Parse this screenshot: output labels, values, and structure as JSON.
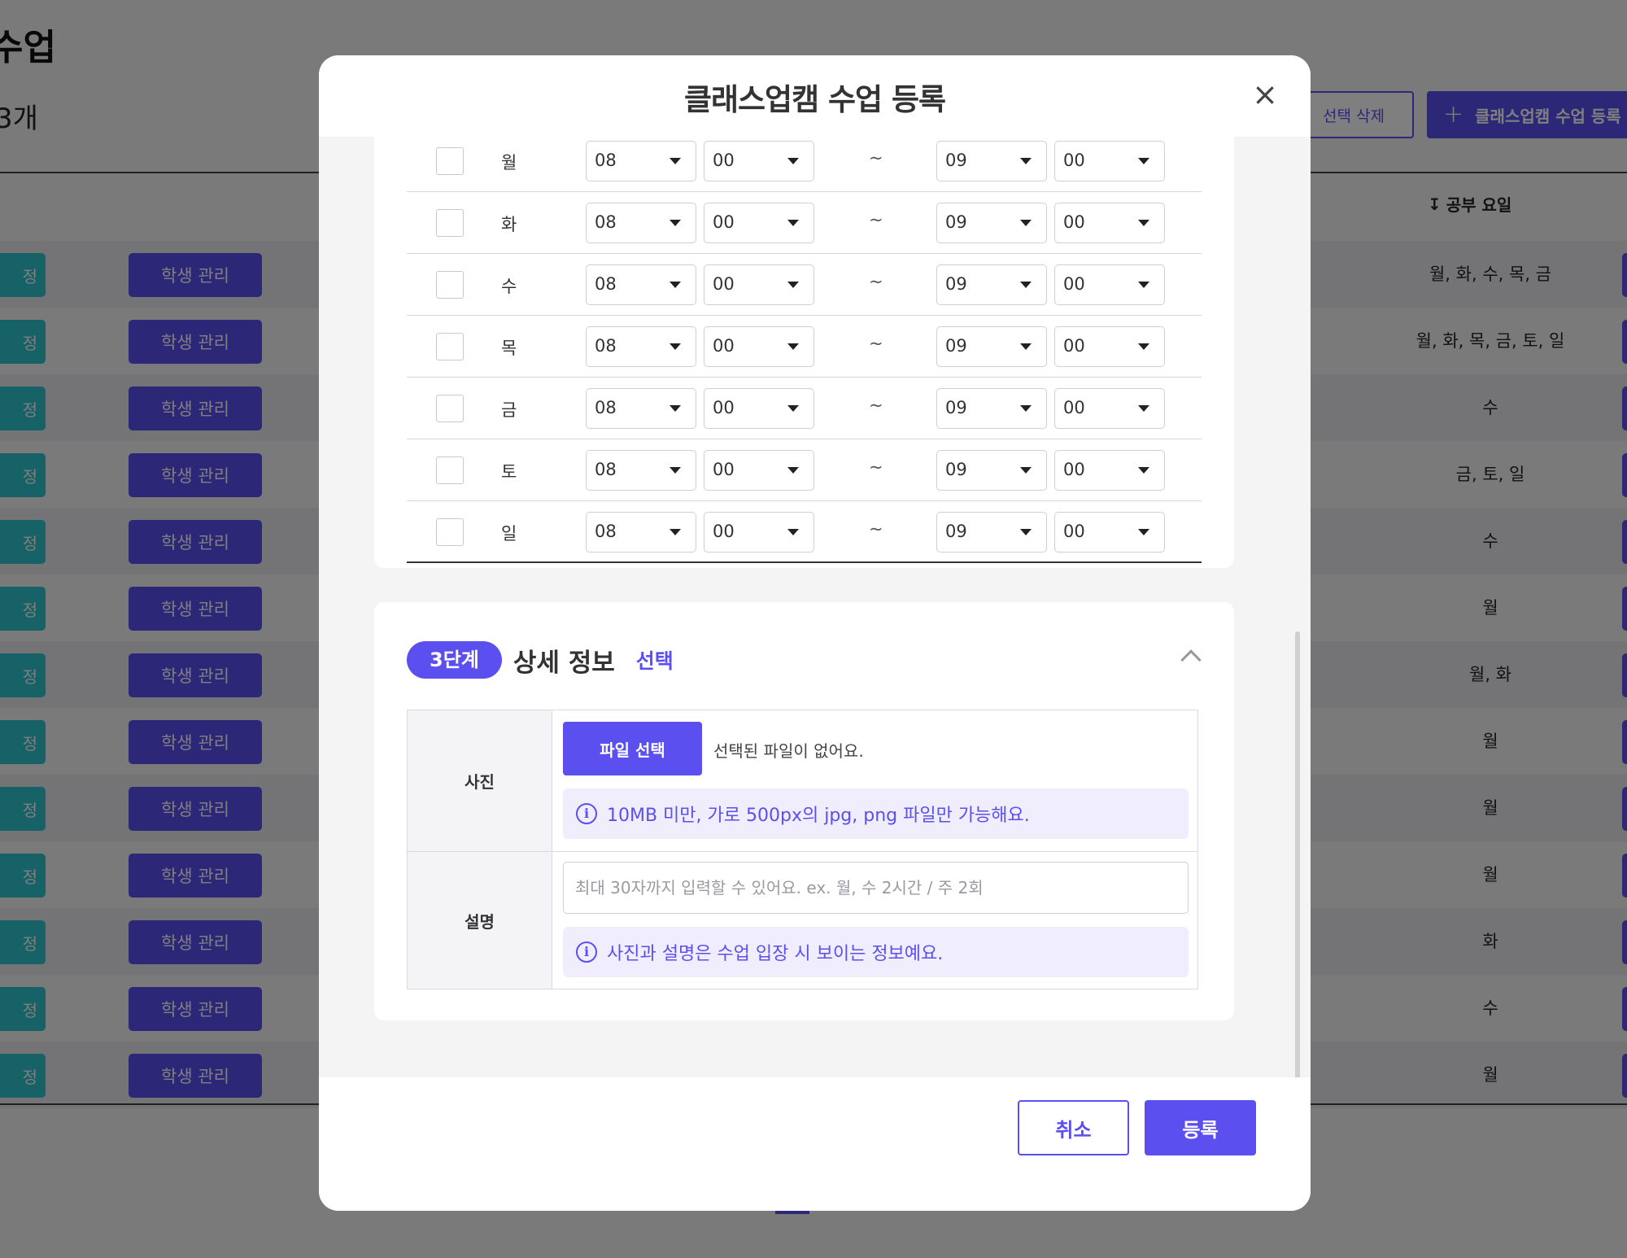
{
  "background": {
    "page_title": "수업",
    "count_text": "3개",
    "delete_button": "선택 삭제",
    "register_button": "클래스업캠 수업 등록",
    "day_column_header": "공부 요일",
    "row_teal_label": "정",
    "row_manage_label": "학생 관리",
    "rows": [
      {
        "days": "월, 화, 수, 목, 금"
      },
      {
        "days": "월, 화, 목, 금, 토, 일"
      },
      {
        "days": "수"
      },
      {
        "days": "금, 토, 일"
      },
      {
        "days": "수"
      },
      {
        "days": "월"
      },
      {
        "days": "월, 화"
      },
      {
        "days": "월"
      },
      {
        "days": "월"
      },
      {
        "days": "월"
      },
      {
        "days": "화"
      },
      {
        "days": "수"
      },
      {
        "days": "월"
      }
    ]
  },
  "modal": {
    "title": "클래스업캠 수업 등록",
    "close_label": "×",
    "schedule": {
      "rows": [
        {
          "day": "월",
          "start_hour": "08",
          "start_min": "00",
          "end_hour": "09",
          "end_min": "00"
        },
        {
          "day": "화",
          "start_hour": "08",
          "start_min": "00",
          "end_hour": "09",
          "end_min": "00"
        },
        {
          "day": "수",
          "start_hour": "08",
          "start_min": "00",
          "end_hour": "09",
          "end_min": "00"
        },
        {
          "day": "목",
          "start_hour": "08",
          "start_min": "00",
          "end_hour": "09",
          "end_min": "00"
        },
        {
          "day": "금",
          "start_hour": "08",
          "start_min": "00",
          "end_hour": "09",
          "end_min": "00"
        },
        {
          "day": "토",
          "start_hour": "08",
          "start_min": "00",
          "end_hour": "09",
          "end_min": "00"
        },
        {
          "day": "일",
          "start_hour": "08",
          "start_min": "00",
          "end_hour": "09",
          "end_min": "00"
        }
      ],
      "separator": "~"
    },
    "step3": {
      "badge": "3단계",
      "title": "상세 정보",
      "optional": "선택",
      "photo_label": "사진",
      "file_button": "파일 선택",
      "file_status": "선택된 파일이 없어요.",
      "photo_info": "10MB 미만, 가로 500px의 jpg, png 파일만 가능해요.",
      "desc_label": "설명",
      "desc_placeholder": "최대 30자까지 입력할 수 있어요. ex. 월, 수 2시간 / 주 2회",
      "desc_value": "",
      "desc_info": "사진과 설명은 수업 입장 시 보이는 정보예요."
    },
    "footer": {
      "cancel": "취소",
      "submit": "등록"
    }
  },
  "colors": {
    "accent": "#5b4ff0",
    "teal": "#2fc4cf",
    "info_bg": "#f0eefd"
  }
}
